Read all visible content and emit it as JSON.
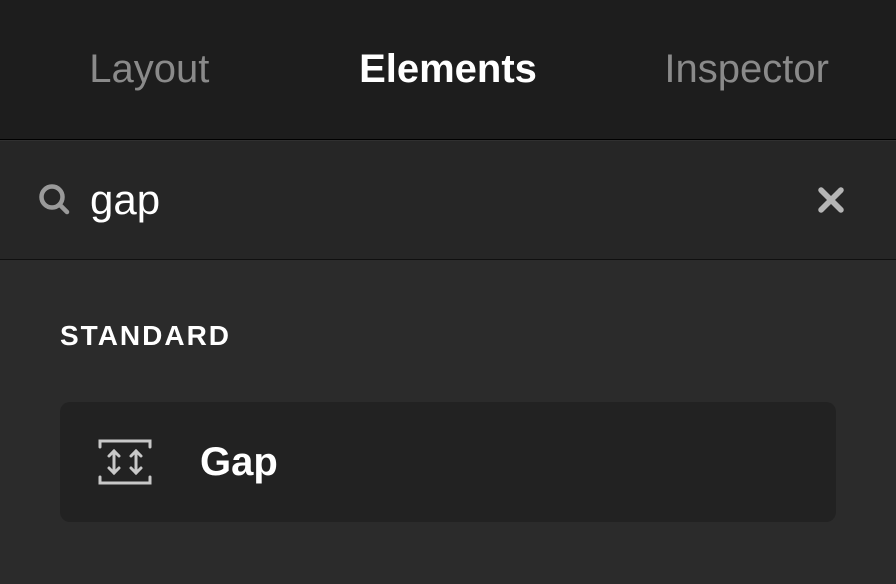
{
  "tabs": {
    "layout": "Layout",
    "elements": "Elements",
    "inspector": "Inspector",
    "active": "elements"
  },
  "search": {
    "value": "gap",
    "icon": "search-icon",
    "clear_icon": "close-icon"
  },
  "results": {
    "section_header": "STANDARD",
    "items": [
      {
        "label": "Gap",
        "icon": "gap-icon"
      }
    ]
  }
}
